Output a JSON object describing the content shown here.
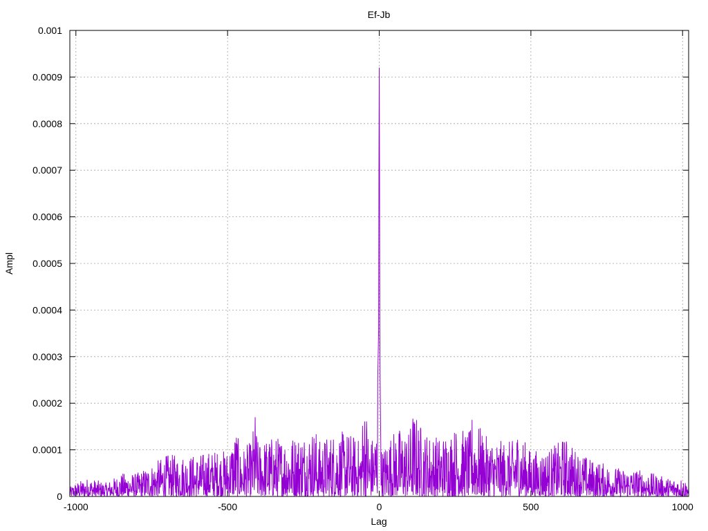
{
  "chart_data": {
    "type": "line",
    "title": "Ef-Jb",
    "xlabel": "Lag",
    "ylabel": "Ampl",
    "xlim": [
      -1020,
      1020
    ],
    "ylim": [
      0,
      0.001
    ],
    "xticks": [
      -1000,
      -500,
      0,
      500,
      1000
    ],
    "yticks": [
      0,
      0.0001,
      0.0002,
      0.0003,
      0.0004,
      0.0005,
      0.0006,
      0.0007,
      0.0008,
      0.0009,
      0.001
    ],
    "ytick_labels": [
      "0",
      "0.0001",
      "0.0002",
      "0.0003",
      "0.0004",
      "0.0005",
      "0.0006",
      "0.0007",
      "0.0008",
      "0.0009",
      "0.001"
    ],
    "xtick_labels": [
      "-1000",
      "-500",
      "0",
      "500",
      "1000"
    ],
    "grid": true,
    "series_color": "#9400d3",
    "series": [
      {
        "x": [
          -1020,
          -1000,
          -960,
          -900,
          -850,
          -800,
          -750,
          -700,
          -650,
          -600,
          -550,
          -500,
          -470,
          -460,
          -420,
          -410,
          -400,
          -350,
          -300,
          -250,
          -210,
          -200,
          -150,
          -100,
          -60,
          -50,
          -30,
          -10,
          -5,
          -2,
          -1,
          0,
          1,
          2,
          3,
          5,
          10,
          30,
          60,
          100,
          110,
          150,
          200,
          250,
          300,
          305,
          350,
          400,
          440,
          450,
          500,
          550,
          600,
          610,
          650,
          700,
          750,
          800,
          850,
          900,
          950,
          1000,
          1020
        ],
        "y": [
          2e-05,
          3e-05,
          4e-05,
          3e-05,
          5e-05,
          5e-05,
          7e-05,
          9e-05,
          9e-05,
          9e-05,
          0.0001,
          0.0001,
          0.00015,
          0.0001,
          0.00012,
          0.00019,
          0.00012,
          0.00013,
          0.00013,
          0.00014,
          0.00015,
          0.00012,
          0.00014,
          0.00014,
          0.00012,
          0.00023,
          0.00012,
          0.00015,
          0.00025,
          0.00036,
          0.0007,
          0.00092,
          0.0007,
          0.00036,
          0.00025,
          0.00012,
          0.0001,
          0.00013,
          0.00015,
          0.00014,
          0.00019,
          0.00014,
          0.00013,
          0.00015,
          0.00014,
          0.00018,
          0.00013,
          0.00012,
          0.00012,
          0.00015,
          0.0001,
          0.0001,
          0.00012,
          0.00013,
          0.0001,
          8e-05,
          7e-05,
          6e-05,
          6e-05,
          5e-05,
          4e-05,
          4e-05,
          3e-05
        ]
      }
    ]
  }
}
